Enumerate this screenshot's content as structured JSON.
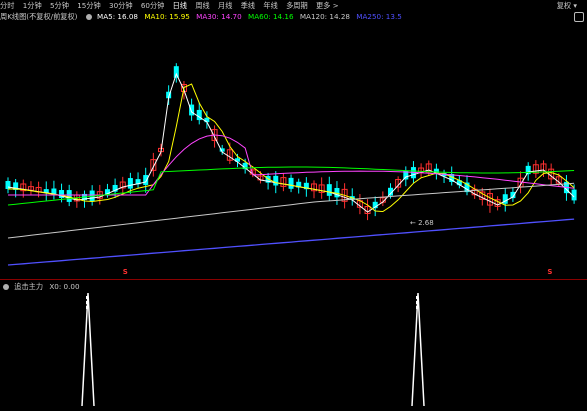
{
  "timeframe_tabs": [
    "分时",
    "1分钟",
    "5分钟",
    "15分钟",
    "30分钟",
    "60分钟",
    "日线",
    "周线",
    "月线",
    "季线",
    "年线",
    "多周期",
    "更多 >"
  ],
  "active_tab": "日线",
  "top_right_label": "复权 ▾",
  "ma_legend": {
    "title": "周K线图(不复权/前复权)",
    "items": [
      {
        "label": "MA5: 16.08",
        "color": "#ffffff"
      },
      {
        "label": "MA10: 15.95",
        "color": "#ffff00"
      },
      {
        "label": "MA30: 14.70",
        "color": "#ff44ff"
      },
      {
        "label": "MA60: 14.16",
        "color": "#00ff00"
      },
      {
        "label": "MA120: 14.28",
        "color": "#c8c8c8"
      },
      {
        "label": "MA250: 13.5",
        "color": "#5050ff"
      }
    ]
  },
  "price_labels": {
    "low_marker": "2.68"
  },
  "indicator_legend": {
    "name": "追击主力",
    "value_label": "X0: 0.00"
  },
  "colors": {
    "up": "#ff3030",
    "down": "#00ffff",
    "ma5": "#ffffff",
    "ma10": "#ffff00",
    "ma30": "#ff44ff",
    "ma60": "#00ff00",
    "ma120": "#c8c8c8",
    "ma250": "#5050ff"
  },
  "chart_data": {
    "type": "candlestick",
    "signals_S_at_index": [
      10,
      47
    ],
    "indicator_spikes_at_index": [
      10,
      46
    ],
    "indicator_legend_value": 0.0
  }
}
